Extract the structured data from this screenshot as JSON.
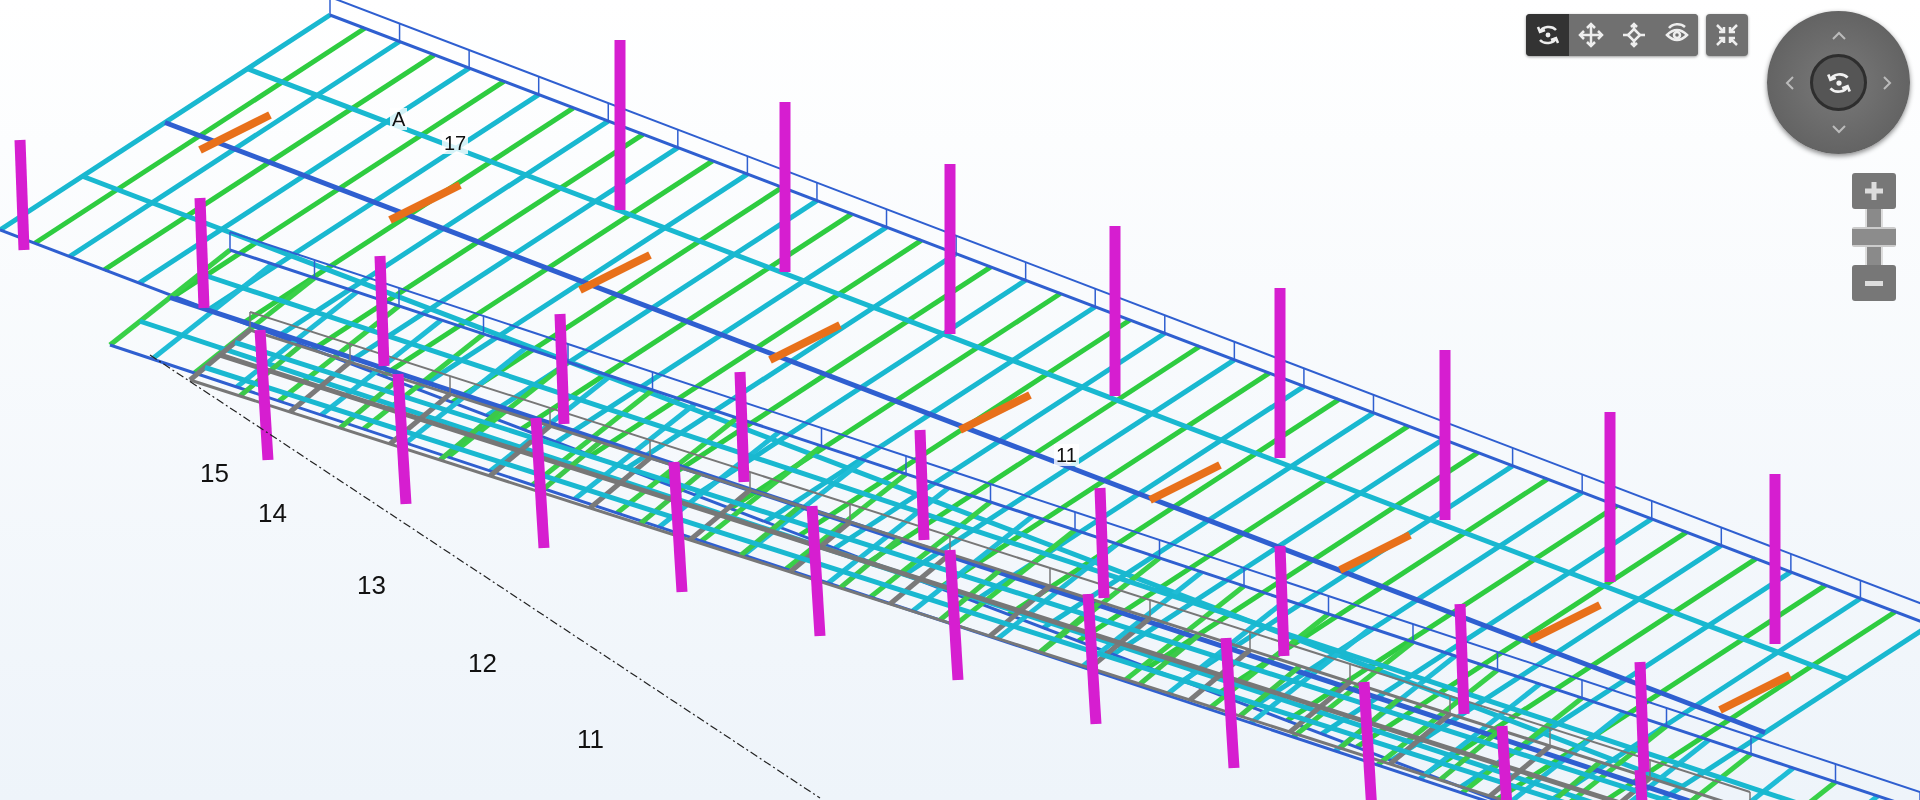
{
  "toolbar": {
    "buttons": [
      {
        "kind": "rotate",
        "selected": true
      },
      {
        "kind": "pan",
        "selected": false
      },
      {
        "kind": "orbit",
        "selected": false
      },
      {
        "kind": "look",
        "selected": false
      }
    ]
  },
  "zoom": {
    "level": 0.5
  },
  "grid_labels": [
    "15",
    "14",
    "13",
    "12",
    "11"
  ],
  "model_labels": [
    "A",
    "17",
    "11"
  ]
}
